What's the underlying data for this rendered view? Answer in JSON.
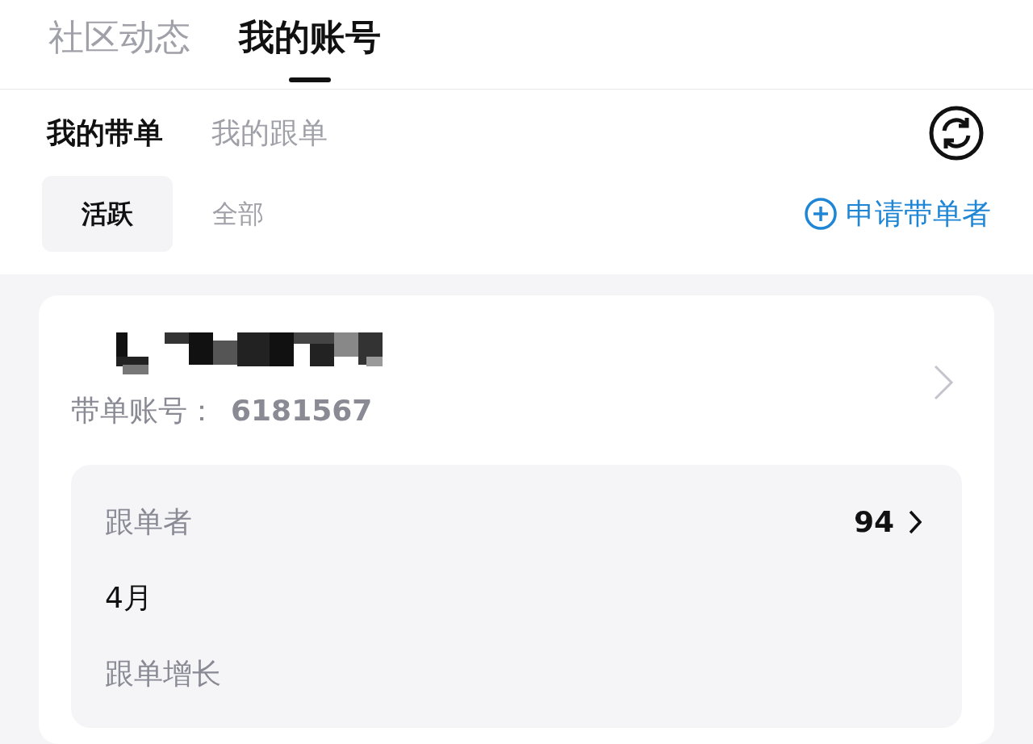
{
  "top_tabs": [
    {
      "label": "社区动态",
      "selected": false
    },
    {
      "label": "我的账号",
      "selected": true
    }
  ],
  "sub_tabs": [
    {
      "label": "我的带单",
      "selected": true
    },
    {
      "label": "我的跟单",
      "selected": false
    }
  ],
  "filters": [
    {
      "label": "活跃",
      "selected": true
    },
    {
      "label": "全部",
      "selected": false
    }
  ],
  "apply_button": {
    "label": "申请带单者"
  },
  "card": {
    "account_label": "带单账号：",
    "account_number": "6181567",
    "stats": [
      {
        "label": "跟单者",
        "value": "94"
      }
    ],
    "month": "4月",
    "growth_label": "跟单增长"
  }
}
